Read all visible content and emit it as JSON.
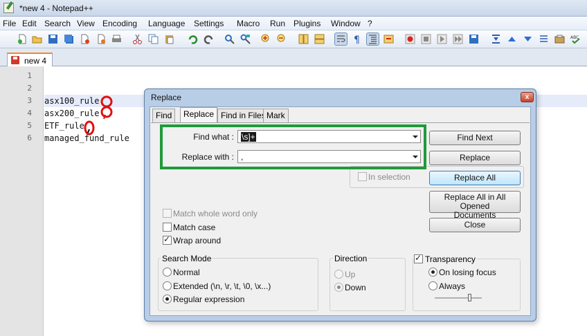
{
  "window": {
    "title": "*new  4 - Notepad++"
  },
  "menu": [
    "File",
    "Edit",
    "Search",
    "View",
    "Encoding",
    "Language",
    "Settings",
    "Macro",
    "Run",
    "Plugins",
    "Window",
    "?"
  ],
  "toolbar": {
    "icons": [
      "new-file-icon",
      "open-file-icon",
      "save-icon",
      "save-all-icon",
      "close-icon",
      "close-all-icon",
      "print-icon",
      "cut-icon",
      "copy-icon",
      "paste-icon",
      "undo-icon",
      "redo-icon",
      "find-icon",
      "replace-icon",
      "zoom-in-icon",
      "zoom-out-icon",
      "sync-vertical-icon",
      "sync-horizontal-icon",
      "word-wrap-icon",
      "show-all-chars-icon",
      "indent-guide-icon",
      "user-language-icon",
      "record-macro-icon",
      "stop-macro-icon",
      "play-macro-icon",
      "play-multiple-icon",
      "save-macro-icon",
      "fold-all-icon",
      "prev-bookmark-icon",
      "next-bookmark-icon",
      "unfold-icon",
      "doc-map-icon",
      "function-list-icon",
      "spell-check-icon"
    ]
  },
  "document_tab": {
    "label": "new  4"
  },
  "editor": {
    "lines": [
      {
        "num": "1",
        "text": ""
      },
      {
        "num": "2",
        "text": ""
      },
      {
        "num": "3",
        "text": "asx100_rule"
      },
      {
        "num": "4",
        "text": "asx200_rule"
      },
      {
        "num": "5",
        "text": "ETF_rule"
      },
      {
        "num": "6",
        "text": "managed_fund_rule"
      }
    ],
    "handwritten_annotations": [
      "8",
      ",",
      ","
    ]
  },
  "dialog": {
    "title": "Replace",
    "close_glyph": "x",
    "tabs": [
      "Find",
      "Replace",
      "Find in Files",
      "Mark"
    ],
    "active_tab": "Replace",
    "find_what": {
      "label": "Find what :",
      "value": "\\s]+"
    },
    "replace_with": {
      "label": "Replace with :",
      "value": ","
    },
    "buttons": {
      "find_next": "Find Next",
      "replace": "Replace",
      "replace_all": "Replace All",
      "replace_all_opened_1": "Replace All in All Opened",
      "replace_all_opened_2": "Documents",
      "close": "Close"
    },
    "in_selection": {
      "label": "In selection",
      "checked": false,
      "enabled": false
    },
    "options": {
      "match_whole_word": {
        "label": "Match whole word only",
        "checked": false,
        "enabled": false
      },
      "match_case": {
        "label": "Match case",
        "checked": false
      },
      "wrap_around": {
        "label": "Wrap around",
        "checked": true
      }
    },
    "search_mode": {
      "title": "Search Mode",
      "normal": "Normal",
      "extended": "Extended (\\n, \\r, \\t, \\0, \\x...)",
      "regex": "Regular expression",
      "selected": "Regular expression"
    },
    "direction": {
      "title": "Direction",
      "up": "Up",
      "down": "Down",
      "selected": "Down",
      "enabled": false
    },
    "transparency": {
      "title": "Transparency",
      "checked": true,
      "on_losing_focus": "On losing focus",
      "always": "Always",
      "selected": "On losing focus",
      "level": 0.75
    }
  },
  "colors": {
    "highlight_box": "#1f9a3a",
    "annotation": "#e01010",
    "tab_accent": "#f08a24"
  }
}
